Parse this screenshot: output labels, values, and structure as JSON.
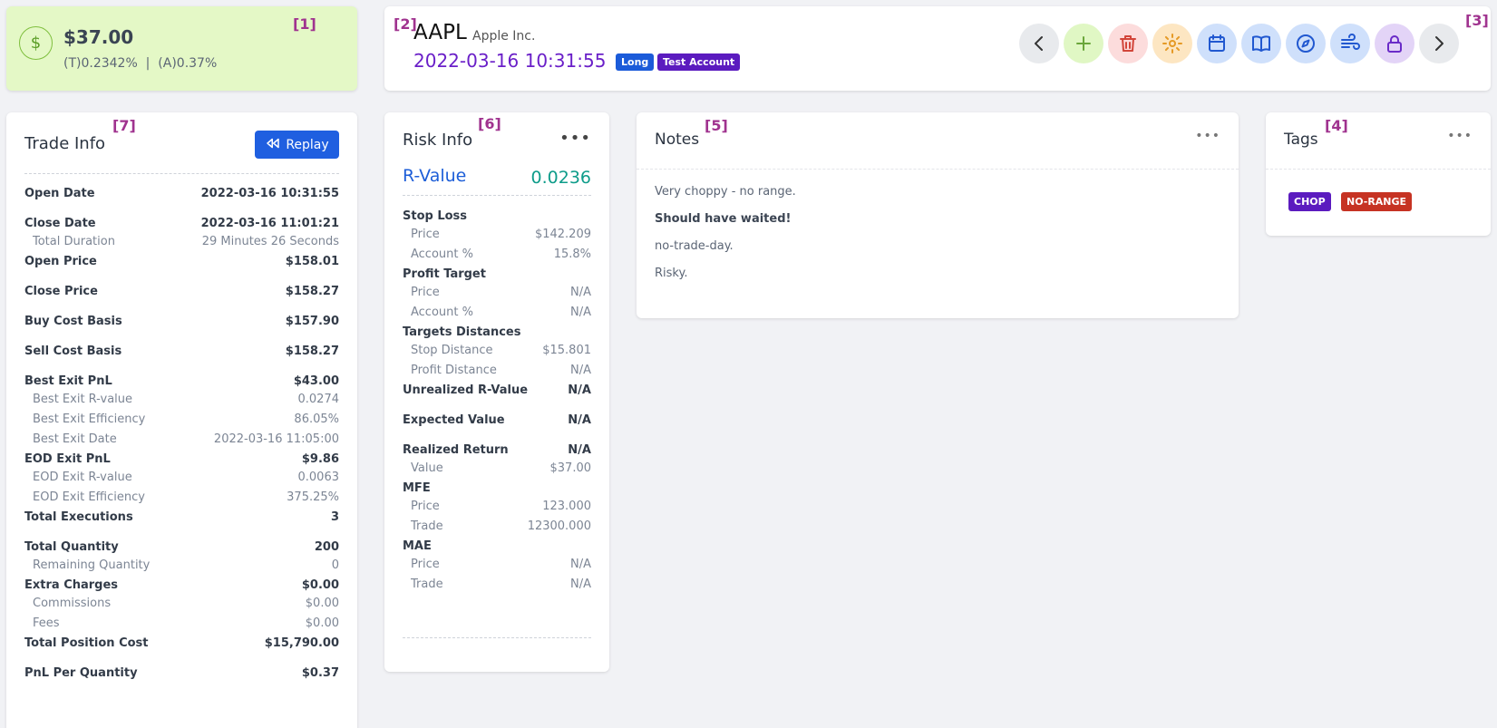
{
  "summary": {
    "icon": "dollar-icon",
    "pnl": "$37.00",
    "pct": "(T)0.2342%  |  (A)0.37%"
  },
  "markers": {
    "m1": "[1]",
    "m2": "[2]",
    "m3": "[3]",
    "m4": "[4]",
    "m5": "[5]",
    "m6": "[6]",
    "m7": "[7]"
  },
  "header": {
    "symbol": "AAPL",
    "company": "Apple Inc.",
    "datetime": "2022-03-16 10:31:55",
    "badge_direction": "Long",
    "badge_account": "Test Account",
    "icons": [
      "chevron-left-icon",
      "plus-icon",
      "trash-icon",
      "gear-icon",
      "calendar-icon",
      "book-icon",
      "compass-icon",
      "wind-icon",
      "lock-icon",
      "chevron-right-icon"
    ]
  },
  "trade": {
    "title": "Trade Info",
    "replay_label": "Replay",
    "rows": [
      {
        "label": "Open Date",
        "value": "2022-03-16 10:31:55"
      },
      {
        "label": "Close Date",
        "value": "2022-03-16 11:01:21"
      },
      {
        "label": "Total Duration",
        "value": "29 Minutes 26 Seconds"
      },
      {
        "label": "Open Price",
        "value": "$158.01"
      },
      {
        "label": "Close Price",
        "value": "$158.27"
      },
      {
        "label": "Buy Cost Basis",
        "value": "$157.90"
      },
      {
        "label": "Sell Cost Basis",
        "value": "$158.27"
      },
      {
        "label": "Best Exit PnL",
        "value": "$43.00"
      },
      {
        "label": "Best Exit R-value",
        "value": "0.0274"
      },
      {
        "label": "Best Exit Efficiency",
        "value": "86.05%"
      },
      {
        "label": "Best Exit Date",
        "value": "2022-03-16 11:05:00"
      },
      {
        "label": "EOD Exit PnL",
        "value": "$9.86"
      },
      {
        "label": "EOD Exit R-value",
        "value": "0.0063"
      },
      {
        "label": "EOD Exit Efficiency",
        "value": "375.25%"
      },
      {
        "label": "Total Executions",
        "value": "3"
      },
      {
        "label": "Total Quantity",
        "value": "200"
      },
      {
        "label": "Remaining Quantity",
        "value": "0"
      },
      {
        "label": "Extra Charges",
        "value": "$0.00"
      },
      {
        "label": "Commissions",
        "value": "$0.00"
      },
      {
        "label": "Fees",
        "value": "$0.00"
      },
      {
        "label": "Total Position Cost",
        "value": "$15,790.00"
      },
      {
        "label": "PnL Per Quantity",
        "value": "$0.37"
      }
    ]
  },
  "risk": {
    "title": "Risk Info",
    "more": "•••",
    "r_label": "R-Value",
    "r_value": "0.0236",
    "rows": [
      {
        "label": "Stop Loss",
        "value": ""
      },
      {
        "label": "Price",
        "value": "$142.209"
      },
      {
        "label": "Account %",
        "value": "15.8%"
      },
      {
        "label": "Profit Target",
        "value": ""
      },
      {
        "label": "Price",
        "value": "N/A"
      },
      {
        "label": "Account %",
        "value": "N/A"
      },
      {
        "label": "Targets Distances",
        "value": ""
      },
      {
        "label": "Stop Distance",
        "value": "$15.801"
      },
      {
        "label": "Profit Distance",
        "value": "N/A"
      },
      {
        "label": "Unrealized R-Value",
        "value": "N/A"
      },
      {
        "label": "Expected Value",
        "value": "N/A"
      },
      {
        "label": "Realized Return",
        "value": "N/A"
      },
      {
        "label": "Value",
        "value": "$37.00"
      },
      {
        "label": "MFE",
        "value": ""
      },
      {
        "label": "Price",
        "value": "123.000"
      },
      {
        "label": "Trade",
        "value": "12300.000"
      },
      {
        "label": "MAE",
        "value": ""
      },
      {
        "label": "Price",
        "value": "N/A"
      },
      {
        "label": "Trade",
        "value": "N/A"
      }
    ]
  },
  "notes": {
    "title": "Notes",
    "more": "•••",
    "lines": [
      "Very choppy - no range.",
      "Should have waited!",
      "no-trade-day.",
      "Risky."
    ]
  },
  "tags": {
    "title": "Tags",
    "more": "•••",
    "items": [
      "CHOP",
      "NO-RANGE"
    ]
  }
}
